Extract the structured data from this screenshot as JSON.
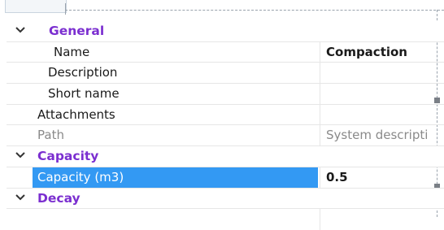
{
  "categories": {
    "general": "General",
    "capacity": "Capacity",
    "decay": "Decay"
  },
  "rows": {
    "name": {
      "label": "Name",
      "value": "Compaction"
    },
    "description": {
      "label": "Description",
      "value": ""
    },
    "short_name": {
      "label": "Short name",
      "value": ""
    },
    "attachments": {
      "label": "Attachments",
      "value": ""
    },
    "path": {
      "label": "Path",
      "value": "System descripti"
    },
    "capacity_m3": {
      "label": "Capacity (m3)",
      "value": "0.5"
    },
    "partial": {
      "label": "",
      "value": ""
    }
  },
  "colors": {
    "category_text": "#7b2fd0",
    "selection": "#3399f3"
  },
  "icons": {
    "chevron": "chevron-down-icon"
  }
}
